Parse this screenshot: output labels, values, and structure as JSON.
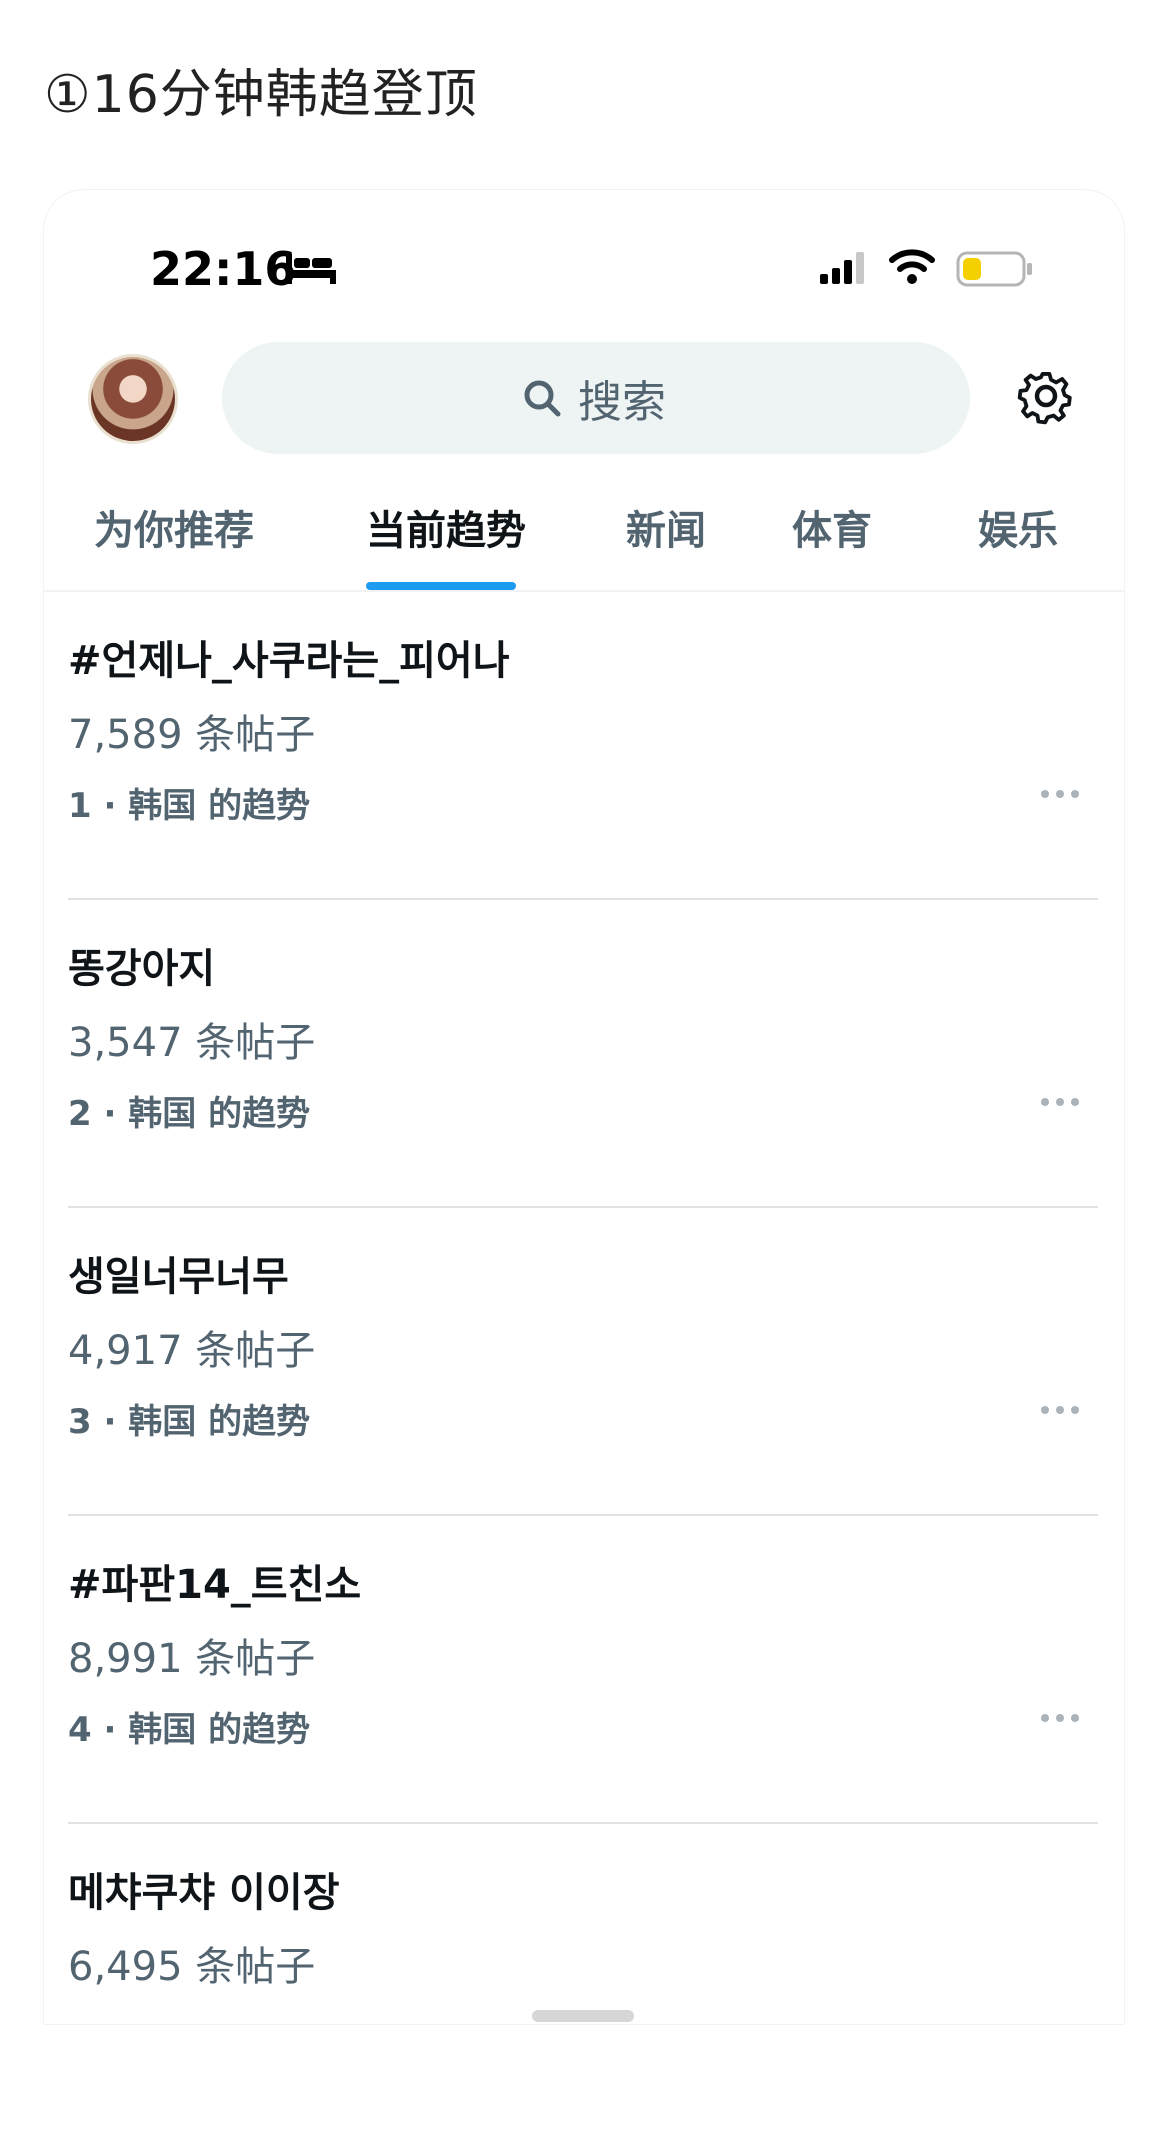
{
  "caption": "①16分钟韩趋登顶",
  "status_bar": {
    "time": "22:16",
    "icons": [
      "bed-icon",
      "signal-icon",
      "wifi-icon",
      "battery-icon"
    ],
    "battery_color": "#f5d000"
  },
  "header": {
    "avatar": "avatar",
    "search_placeholder": "搜索",
    "settings_icon": "gear-icon"
  },
  "tabs": [
    {
      "label": "为你推荐",
      "active": false
    },
    {
      "label": "当前趋势",
      "active": true
    },
    {
      "label": "新闻",
      "active": false
    },
    {
      "label": "体育",
      "active": false
    },
    {
      "label": "娱乐",
      "active": false
    }
  ],
  "accent_color": "#1d9bf0",
  "trends": [
    {
      "title": "#언제나_사쿠라는_피어나",
      "count": "7,589 条帖子",
      "meta": "1 · 韩国 的趋势"
    },
    {
      "title": "똥강아지",
      "count": "3,547 条帖子",
      "meta": "2 · 韩国 的趋势"
    },
    {
      "title": "생일너무너무",
      "count": "4,917 条帖子",
      "meta": "3 · 韩国 的趋势"
    },
    {
      "title": "#파판14_트친소",
      "count": "8,991 条帖子",
      "meta": "4 · 韩国 的趋势"
    },
    {
      "title": "메챠쿠챠 이이장",
      "count": "6,495 条帖子",
      "meta": ""
    }
  ]
}
